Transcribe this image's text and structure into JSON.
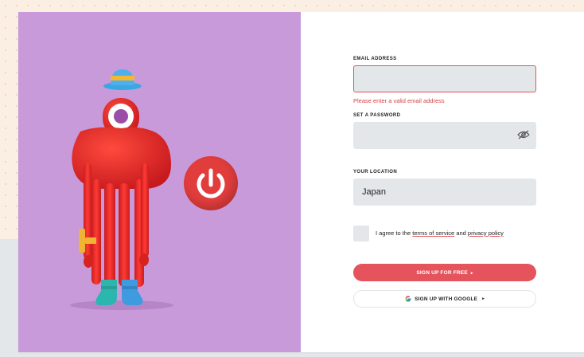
{
  "colors": {
    "accent": "#e5545c",
    "error": "#d94047",
    "panel_purple": "#c89ada",
    "input_bg": "#e4e7ea"
  },
  "form": {
    "email_label": "EMAIL ADDRESS",
    "email_value": "",
    "email_error": "Please enter a valid email address",
    "password_label": "SET A PASSWORD",
    "password_value": "",
    "password_toggle_icon": "eye-slash-icon",
    "location_label": "YOUR LOCATION",
    "location_value": "Japan",
    "agree_prefix": "I agree to the ",
    "terms_link": "terms of service",
    "agree_and": " and ",
    "privacy_link": "privacy policy",
    "signup_label": "SIGN UP FOR FREE",
    "google_label": "SIGN UP WITH GOOGLE",
    "arrow": "▸"
  },
  "illustration": {
    "character": "red-cyclops-mascot",
    "badge_icon": "power-icon"
  }
}
